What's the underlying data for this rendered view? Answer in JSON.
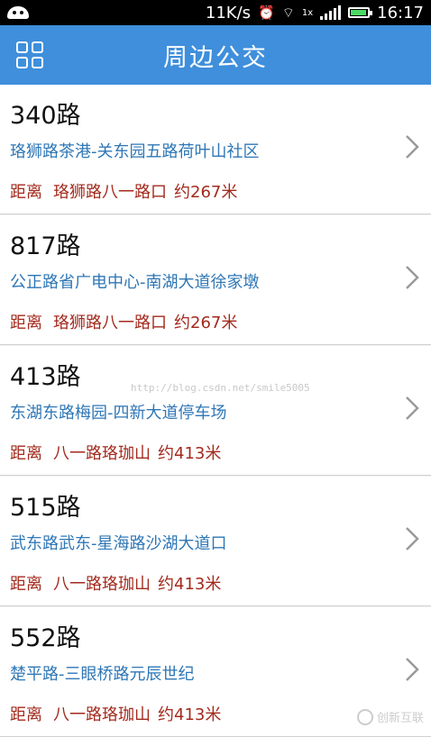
{
  "status_bar": {
    "net_speed": "11K/s",
    "time": "16:17",
    "signal_label": "1x"
  },
  "header": {
    "title": "周边公交",
    "menu_icon": "grid-icon"
  },
  "routes": [
    {
      "name": "340路",
      "line": "珞狮路茶港-关东园五路荷叶山社区",
      "dist_label": "距离",
      "stop": "珞狮路八一路口",
      "distance": "约267米"
    },
    {
      "name": "817路",
      "line": "公正路省广电中心-南湖大道徐家墩",
      "dist_label": "距离",
      "stop": "珞狮路八一路口",
      "distance": "约267米"
    },
    {
      "name": "413路",
      "line": "东湖东路梅园-四新大道停车场",
      "dist_label": "距离",
      "stop": "八一路珞珈山",
      "distance": "约413米"
    },
    {
      "name": "515路",
      "line": "武东路武东-星海路沙湖大道口",
      "dist_label": "距离",
      "stop": "八一路珞珈山",
      "distance": "约413米"
    },
    {
      "name": "552路",
      "line": "楚平路-三眼桥路元辰世纪",
      "dist_label": "距离",
      "stop": "八一路珞珈山",
      "distance": "约413米"
    }
  ],
  "watermark": "http://blog.csdn.net/smile5005",
  "brand": "创新互联"
}
